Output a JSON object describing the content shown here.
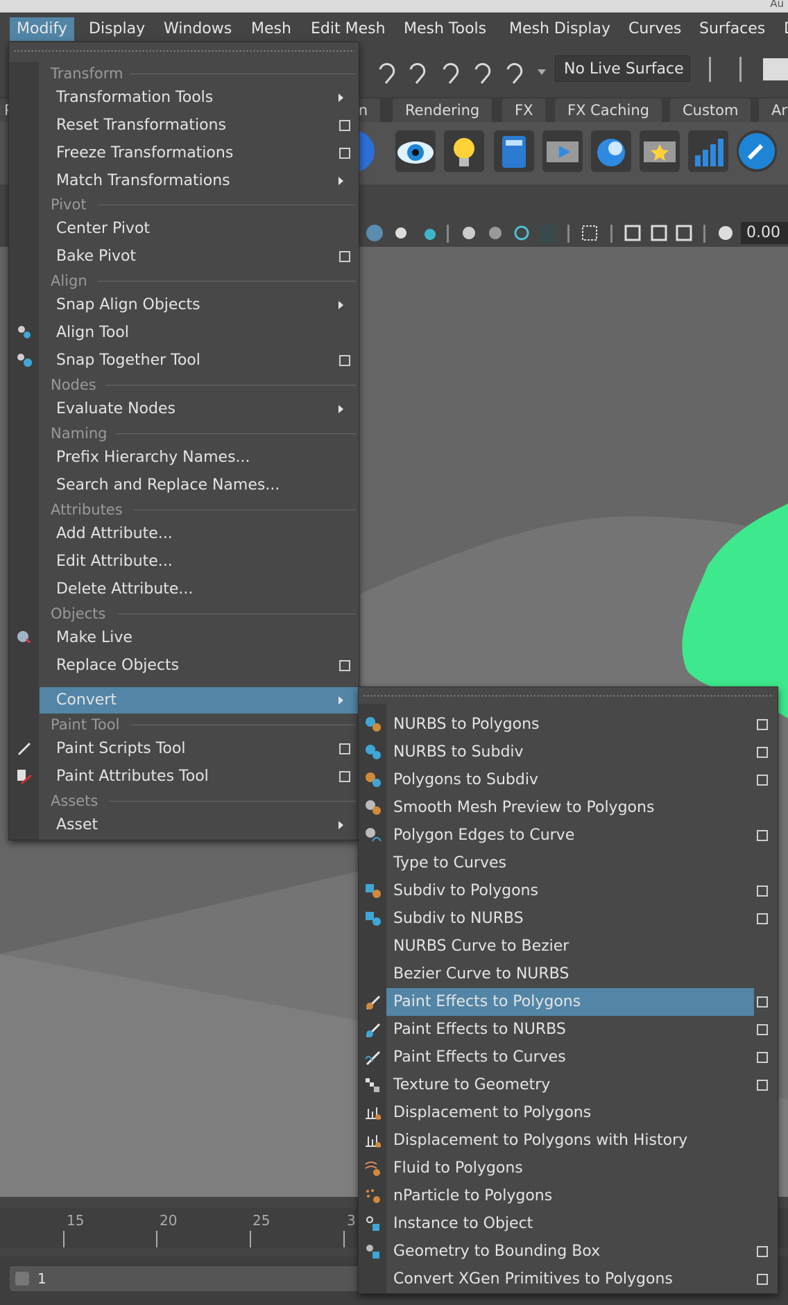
{
  "app": {
    "title_fragment": "Au"
  },
  "menubar": {
    "items": [
      "Modify",
      "Display",
      "Windows",
      "Mesh",
      "Edit Mesh",
      "Mesh Tools",
      "Mesh Display",
      "Curves",
      "Surfaces",
      "D"
    ]
  },
  "toolbar": {
    "live_surface": "No Live Surface"
  },
  "shelf": {
    "tabs": [
      "on",
      "Rendering",
      "FX",
      "FX Caching",
      "Custom",
      "Ar"
    ],
    "left_tab": "P"
  },
  "view": {
    "field_value": "0.00"
  },
  "timeline": {
    "ticks": [
      "15",
      "20",
      "25",
      "3"
    ]
  },
  "bottom": {
    "frame_value": "1"
  },
  "modify_menu": {
    "sections": {
      "transform": "Transform",
      "pivot": "Pivot",
      "align": "Align",
      "nodes": "Nodes",
      "naming": "Naming",
      "attributes": "Attributes",
      "objects": "Objects",
      "paint_tool": "Paint Tool",
      "assets": "Assets"
    },
    "items": {
      "transformation_tools": "Transformation Tools",
      "reset_transformations": "Reset Transformations",
      "freeze_transformations": "Freeze Transformations",
      "match_transformations": "Match Transformations",
      "center_pivot": "Center Pivot",
      "bake_pivot": "Bake Pivot",
      "snap_align_objects": "Snap Align Objects",
      "align_tool": "Align Tool",
      "snap_together_tool": "Snap Together Tool",
      "evaluate_nodes": "Evaluate Nodes",
      "prefix_hierarchy_names": "Prefix Hierarchy Names...",
      "search_replace_names": "Search and Replace Names...",
      "add_attribute": "Add Attribute...",
      "edit_attribute": "Edit Attribute...",
      "delete_attribute": "Delete Attribute...",
      "make_live": "Make Live",
      "replace_objects": "Replace Objects",
      "convert": "Convert",
      "paint_scripts_tool": "Paint Scripts Tool",
      "paint_attributes_tool": "Paint Attributes Tool",
      "asset": "Asset"
    }
  },
  "convert_menu": {
    "items": [
      "NURBS to Polygons",
      "NURBS to Subdiv",
      "Polygons to Subdiv",
      "Smooth Mesh Preview to Polygons",
      "Polygon Edges to Curve",
      "Type to Curves",
      "Subdiv to Polygons",
      "Subdiv to NURBS",
      "NURBS Curve to Bezier",
      "Bezier Curve to NURBS",
      "Paint Effects to Polygons",
      "Paint Effects to NURBS",
      "Paint Effects to Curves",
      "Texture to Geometry",
      "Displacement to Polygons",
      "Displacement to Polygons with History",
      "Fluid to Polygons",
      "nParticle to Polygons",
      "Instance to Object",
      "Geometry to Bounding Box",
      "Convert XGen Primitives to Polygons"
    ],
    "highlighted": "Paint Effects to Polygons"
  },
  "colors": {
    "highlight": "#5285a6",
    "menu_bg": "#484848",
    "foliage": "#3ee88c"
  }
}
